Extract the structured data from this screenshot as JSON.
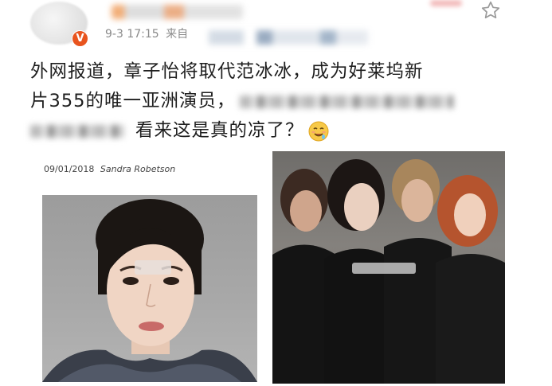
{
  "post": {
    "timestamp": "9-3 17:15",
    "source_prefix": "来自",
    "text_line1": "外网报道，章子怡将取代范冰冰，成为好莱坞新",
    "text_line2": "片355的唯一亚洲演员，",
    "text_line3": "看来这是真的凉了？"
  },
  "image_left": {
    "caption_date": "09/01/2018",
    "caption_author": "Sandra Robetson"
  },
  "icons": {
    "verified_badge": "verified-v-icon",
    "favorite": "star-outline-icon",
    "emoji": "drooling-emoji-icon"
  },
  "colors": {
    "badge": "#e8541e",
    "meta_text": "#8a8a8a",
    "body_text": "#1e1e1e"
  }
}
